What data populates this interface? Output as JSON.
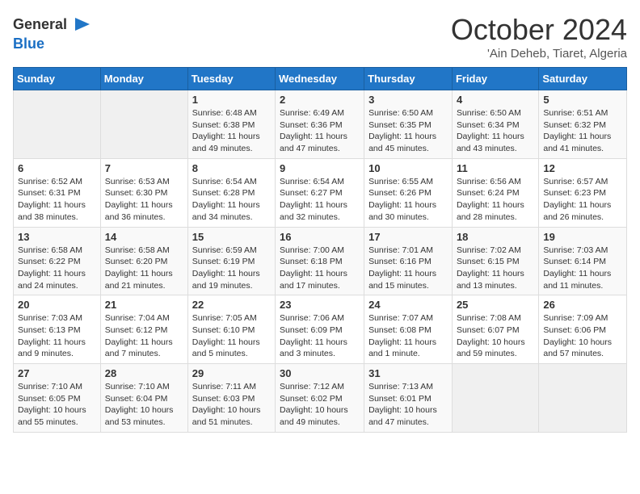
{
  "logo": {
    "general": "General",
    "blue": "Blue"
  },
  "header": {
    "month": "October 2024",
    "location": "'Ain Deheb, Tiaret, Algeria"
  },
  "weekdays": [
    "Sunday",
    "Monday",
    "Tuesday",
    "Wednesday",
    "Thursday",
    "Friday",
    "Saturday"
  ],
  "weeks": [
    [
      {
        "day": "",
        "info": ""
      },
      {
        "day": "",
        "info": ""
      },
      {
        "day": "1",
        "info": "Sunrise: 6:48 AM\nSunset: 6:38 PM\nDaylight: 11 hours and 49 minutes."
      },
      {
        "day": "2",
        "info": "Sunrise: 6:49 AM\nSunset: 6:36 PM\nDaylight: 11 hours and 47 minutes."
      },
      {
        "day": "3",
        "info": "Sunrise: 6:50 AM\nSunset: 6:35 PM\nDaylight: 11 hours and 45 minutes."
      },
      {
        "day": "4",
        "info": "Sunrise: 6:50 AM\nSunset: 6:34 PM\nDaylight: 11 hours and 43 minutes."
      },
      {
        "day": "5",
        "info": "Sunrise: 6:51 AM\nSunset: 6:32 PM\nDaylight: 11 hours and 41 minutes."
      }
    ],
    [
      {
        "day": "6",
        "info": "Sunrise: 6:52 AM\nSunset: 6:31 PM\nDaylight: 11 hours and 38 minutes."
      },
      {
        "day": "7",
        "info": "Sunrise: 6:53 AM\nSunset: 6:30 PM\nDaylight: 11 hours and 36 minutes."
      },
      {
        "day": "8",
        "info": "Sunrise: 6:54 AM\nSunset: 6:28 PM\nDaylight: 11 hours and 34 minutes."
      },
      {
        "day": "9",
        "info": "Sunrise: 6:54 AM\nSunset: 6:27 PM\nDaylight: 11 hours and 32 minutes."
      },
      {
        "day": "10",
        "info": "Sunrise: 6:55 AM\nSunset: 6:26 PM\nDaylight: 11 hours and 30 minutes."
      },
      {
        "day": "11",
        "info": "Sunrise: 6:56 AM\nSunset: 6:24 PM\nDaylight: 11 hours and 28 minutes."
      },
      {
        "day": "12",
        "info": "Sunrise: 6:57 AM\nSunset: 6:23 PM\nDaylight: 11 hours and 26 minutes."
      }
    ],
    [
      {
        "day": "13",
        "info": "Sunrise: 6:58 AM\nSunset: 6:22 PM\nDaylight: 11 hours and 24 minutes."
      },
      {
        "day": "14",
        "info": "Sunrise: 6:58 AM\nSunset: 6:20 PM\nDaylight: 11 hours and 21 minutes."
      },
      {
        "day": "15",
        "info": "Sunrise: 6:59 AM\nSunset: 6:19 PM\nDaylight: 11 hours and 19 minutes."
      },
      {
        "day": "16",
        "info": "Sunrise: 7:00 AM\nSunset: 6:18 PM\nDaylight: 11 hours and 17 minutes."
      },
      {
        "day": "17",
        "info": "Sunrise: 7:01 AM\nSunset: 6:16 PM\nDaylight: 11 hours and 15 minutes."
      },
      {
        "day": "18",
        "info": "Sunrise: 7:02 AM\nSunset: 6:15 PM\nDaylight: 11 hours and 13 minutes."
      },
      {
        "day": "19",
        "info": "Sunrise: 7:03 AM\nSunset: 6:14 PM\nDaylight: 11 hours and 11 minutes."
      }
    ],
    [
      {
        "day": "20",
        "info": "Sunrise: 7:03 AM\nSunset: 6:13 PM\nDaylight: 11 hours and 9 minutes."
      },
      {
        "day": "21",
        "info": "Sunrise: 7:04 AM\nSunset: 6:12 PM\nDaylight: 11 hours and 7 minutes."
      },
      {
        "day": "22",
        "info": "Sunrise: 7:05 AM\nSunset: 6:10 PM\nDaylight: 11 hours and 5 minutes."
      },
      {
        "day": "23",
        "info": "Sunrise: 7:06 AM\nSunset: 6:09 PM\nDaylight: 11 hours and 3 minutes."
      },
      {
        "day": "24",
        "info": "Sunrise: 7:07 AM\nSunset: 6:08 PM\nDaylight: 11 hours and 1 minute."
      },
      {
        "day": "25",
        "info": "Sunrise: 7:08 AM\nSunset: 6:07 PM\nDaylight: 10 hours and 59 minutes."
      },
      {
        "day": "26",
        "info": "Sunrise: 7:09 AM\nSunset: 6:06 PM\nDaylight: 10 hours and 57 minutes."
      }
    ],
    [
      {
        "day": "27",
        "info": "Sunrise: 7:10 AM\nSunset: 6:05 PM\nDaylight: 10 hours and 55 minutes."
      },
      {
        "day": "28",
        "info": "Sunrise: 7:10 AM\nSunset: 6:04 PM\nDaylight: 10 hours and 53 minutes."
      },
      {
        "day": "29",
        "info": "Sunrise: 7:11 AM\nSunset: 6:03 PM\nDaylight: 10 hours and 51 minutes."
      },
      {
        "day": "30",
        "info": "Sunrise: 7:12 AM\nSunset: 6:02 PM\nDaylight: 10 hours and 49 minutes."
      },
      {
        "day": "31",
        "info": "Sunrise: 7:13 AM\nSunset: 6:01 PM\nDaylight: 10 hours and 47 minutes."
      },
      {
        "day": "",
        "info": ""
      },
      {
        "day": "",
        "info": ""
      }
    ]
  ]
}
